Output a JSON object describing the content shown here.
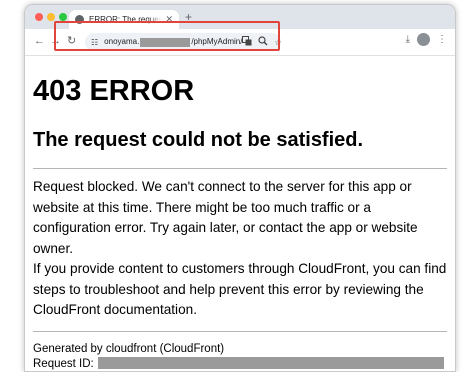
{
  "browser": {
    "tab": {
      "title": "ERROR: The request could not be satisfied",
      "close_glyph": "✕"
    },
    "new_tab_glyph": "+",
    "nav": {
      "back": "←",
      "forward": "→",
      "reload": "↻"
    },
    "address_bar": {
      "url_prefix": "onoyama.",
      "url_suffix": "/phpMyAdmin/",
      "highlight_color": "#e0443a"
    },
    "icons": [
      "tune-icon",
      "translate-icon",
      "zoom-icon",
      "bookmark-star-icon",
      "download-icon",
      "avatar",
      "kebab-menu-icon"
    ]
  },
  "page": {
    "heading": "403 ERROR",
    "subheading": "The request could not be satisfied.",
    "paragraph1": "Request blocked. We can't connect to the server for this app or website at this time. There might be too much traffic or a configuration error. Try again later, or contact the app or website owner.",
    "paragraph2": "If you provide content to customers through CloudFront, you can find steps to troubleshoot and help prevent this error by reviewing the CloudFront documentation.",
    "generated_by": "Generated by cloudfront (CloudFront)",
    "request_id_label": "Request ID:"
  }
}
